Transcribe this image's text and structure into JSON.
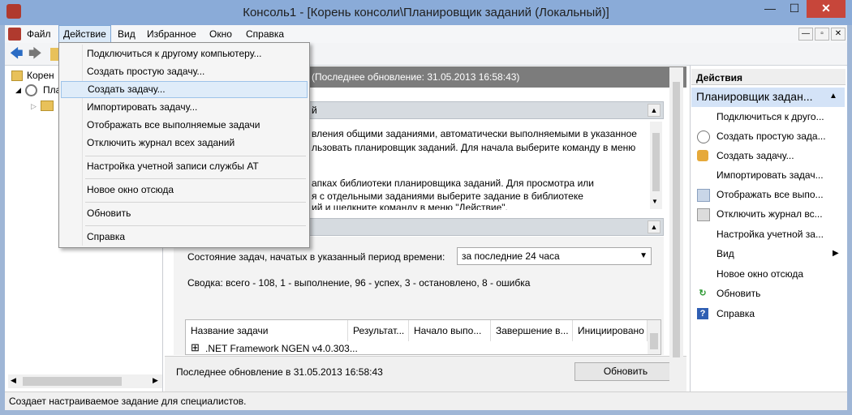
{
  "window": {
    "title": "Консоль1 - [Корень консоли\\Планировщик заданий (Локальный)]",
    "controls": {
      "minimize": "—",
      "maximize": "☐",
      "close": "✕"
    }
  },
  "menubar": {
    "items": [
      "Файл",
      "Действие",
      "Вид",
      "Избранное",
      "Окно",
      "Справка"
    ]
  },
  "dropdown": {
    "items": [
      "Подключиться к другому компьютеру...",
      "Создать простую задачу...",
      "Создать задачу...",
      "Импортировать задачу...",
      "Отображать все выполняемые задачи",
      "Отключить журнал всех заданий",
      "Настройка учетной записи службы AT",
      "Новое окно отсюда",
      "Обновить",
      "Справка"
    ],
    "highlighted_index": 2
  },
  "tree": {
    "root_label": "Корен",
    "child_label": "Пла"
  },
  "center": {
    "header_text": "(Последнее обновление: 31.05.2013 16:58:43)",
    "overview_title_fragment": "й",
    "overview_lines": [
      "вления общими заданиями, автоматически выполняемыми в указанное",
      "льзовать планировщик заданий. Для начала выберите команду в меню"
    ],
    "overview_lines_2": [
      "апках библиотеки планировщика заданий. Для просмотра или",
      "я с отдельными заданиями выберите задание в библиотеке",
      "ий и щелкните команду в меню \"Действие\"."
    ],
    "status_label": "Состояние задач, начатых в указанный период времени:",
    "period_value": "за последние 24 часа",
    "summary": "Сводка: всего - 108, 1 - выполнение, 96 - успех, 3 - остановлено, 8 - ошибка",
    "table": {
      "columns": [
        "Название задачи",
        "Результат...",
        "Начало выпо...",
        "Завершение в...",
        "Инициировано"
      ],
      "row_expander": "⊞",
      "row_label": ".NET Framework NGEN v4.0.303..."
    },
    "last_update": "Последнее обновление в 31.05.2013 16:58:43",
    "refresh_button": "Обновить"
  },
  "actions": {
    "header": "Действия",
    "group_title": "Планировщик задан...",
    "items": [
      {
        "label": "Подключиться к друго...",
        "icon": ""
      },
      {
        "label": "Создать простую зада...",
        "icon": "clock-icon"
      },
      {
        "label": "Создать задачу...",
        "icon": "task-icon"
      },
      {
        "label": "Импортировать задач...",
        "icon": ""
      },
      {
        "label": "Отображать все выпо...",
        "icon": "list-icon"
      },
      {
        "label": "Отключить журнал вс...",
        "icon": "log-icon"
      },
      {
        "label": "Настройка учетной зa...",
        "icon": ""
      },
      {
        "label": "Вид",
        "icon": "",
        "submenu": true
      },
      {
        "label": "Новое окно отсюда",
        "icon": ""
      },
      {
        "label": "Обновить",
        "icon": "refresh-icon"
      },
      {
        "label": "Справка",
        "icon": "help-icon"
      }
    ]
  },
  "statusbar": {
    "text": "Создает настраиваемое задание для специалистов."
  },
  "colors": {
    "titlebar": "#8aabd8",
    "close": "#c7463a",
    "highlight": "#dfecf9",
    "action_group": "#d4e3f7"
  }
}
